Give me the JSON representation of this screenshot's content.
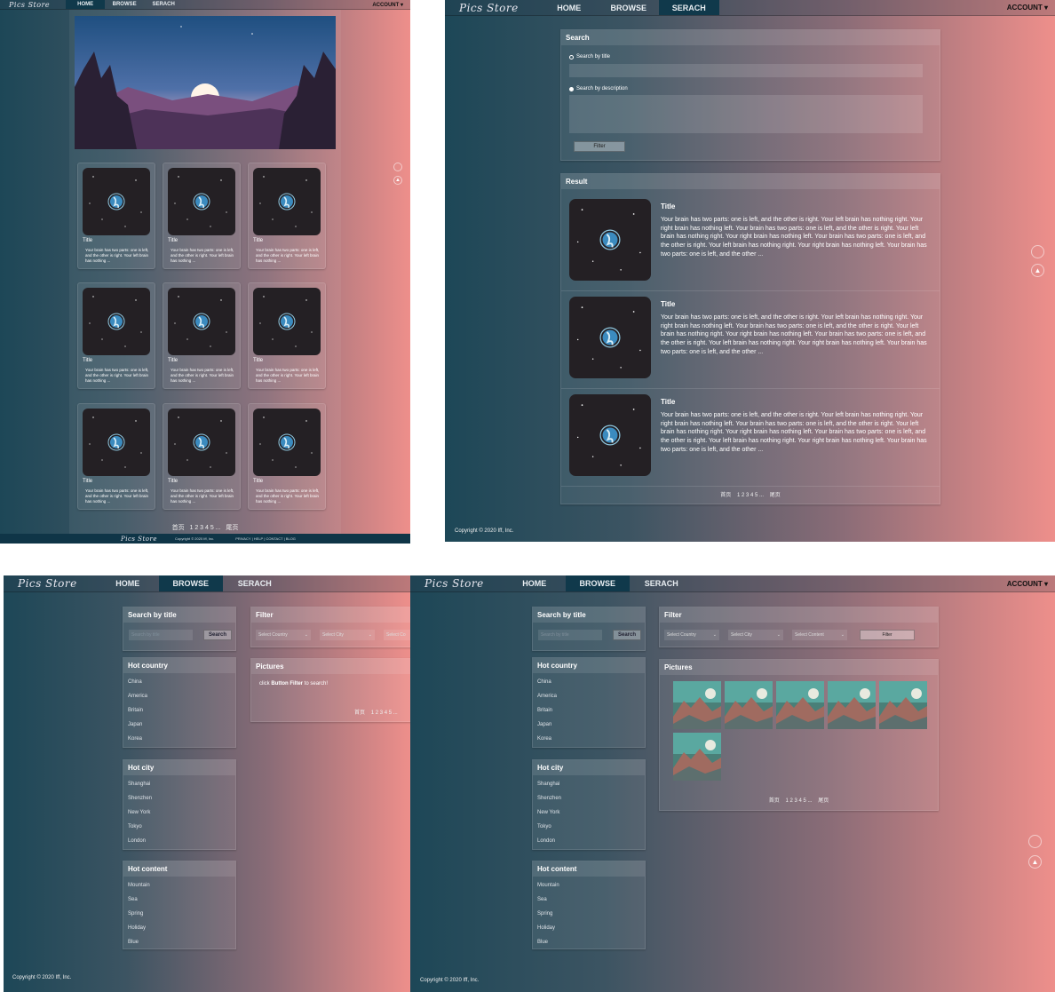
{
  "logo": "Pics Store",
  "nav": {
    "home": "HOME",
    "browse": "BROWSE",
    "search": "SERACH",
    "account": "ACCOUNT ▾"
  },
  "cards": {
    "title": "Title",
    "desc_short": "Your brain has two parts: one is left, and the other is right. Your left brain has nothing ...",
    "desc_long": "Your brain has two parts: one is left, and the other is right. Your left brain has nothing right. Your right brain has nothing left. Your brain has two parts: one is left, and the other is right. Your left brain has nothing right. Your right brain has nothing left. Your brain has two parts: one is left, and the other is right. Your left brain has nothing right. Your right brain has nothing left. Your brain has two parts: one is left, and the other ...",
    "desc_long2": "Your brain has two parts: one is left, and the other is right. Your left brain has nothing right. Your right brain has nothing left. Your brain has two parts: one is left, and the other is right. Your left brain has nothing right. Your right brain has nothing left. Your brain has two parts: one is left, and the other is right. Your left brain has nothing right. Your right brain has nothing left. Your brain has two parts: one is left, and the other ..."
  },
  "pagination": {
    "first": "首页",
    "pages": "1 2 3 4 5 ...",
    "last": "尾页"
  },
  "footer": {
    "copyright_small": "Copyright © 2020 Iff, Inc.",
    "privacy": "PRIVACY",
    "help": "HELP",
    "contact": "CONTACT",
    "blog": "BLOG",
    "copyright": "Copyright © 2020 Iff, Inc."
  },
  "search_page": {
    "search_header": "Search",
    "by_title": "Search by title",
    "by_desc": "Search by description",
    "filter_btn": "Filter",
    "result_header": "Result"
  },
  "browse": {
    "search_by_title": "Search by title",
    "search_placeholder": "Search by title",
    "search_btn": "Search",
    "filter_header": "Filter",
    "select_country": "Select Country",
    "select_city": "Select City",
    "select_content": "Select Content",
    "select_content_cut": "Select Co",
    "filter_btn": "Filter",
    "pictures_header": "Pictures",
    "hint_pre": "click ",
    "hint_bold": "Button Filter",
    "hint_post": " to search!",
    "hot_country": "Hot country",
    "countries": [
      "China",
      "America",
      "Britain",
      "Japan",
      "Korea"
    ],
    "hot_city": "Hot city",
    "cities": [
      "Shanghai",
      "Shenzhen",
      "New York",
      "Tokyo",
      "London"
    ],
    "hot_content": "Hot content",
    "contents": [
      "Mountain",
      "Sea",
      "Spring",
      "Holiday",
      "Blue"
    ]
  }
}
